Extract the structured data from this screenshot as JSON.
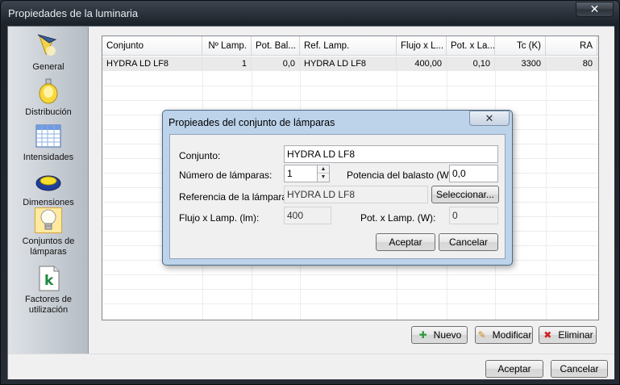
{
  "window": {
    "title": "Propiedades de la luminaria",
    "close_glyph": "✕"
  },
  "sidebar": {
    "items": [
      {
        "label": "General",
        "icon": "lamp-icon"
      },
      {
        "label": "Distribución",
        "icon": "light-distribution-icon"
      },
      {
        "label": "Intensidades",
        "icon": "table-grid-icon"
      },
      {
        "label": "Dimensiones",
        "icon": "luminaire-dimensions-icon"
      },
      {
        "label": "Conjuntos de lámparas",
        "icon": "lightbulb-icon",
        "active": true
      },
      {
        "label": "Factores de utilización",
        "icon": "k-factor-icon"
      }
    ]
  },
  "table": {
    "columns": [
      "Conjunto",
      "Nº Lamp.",
      "Pot. Bal...",
      "Ref. Lamp.",
      "Flujo x L...",
      "Pot. x La...",
      "Tc (K)",
      "RA"
    ],
    "rows": [
      [
        "HYDRA LD LF8",
        "1",
        "0,0",
        "HYDRA LD LF8",
        "400,00",
        "0,10",
        "3300",
        "80"
      ]
    ]
  },
  "actions": {
    "new_label": "Nuevo",
    "edit_label": "Modificar",
    "delete_label": "Eliminar"
  },
  "footer": {
    "ok_label": "Aceptar",
    "cancel_label": "Cancelar"
  },
  "dialog": {
    "title": "Propieades del conjunto de lámparas",
    "close_glyph": "✕",
    "conjunto_label": "Conjunto:",
    "conjunto_value": "HYDRA LD LF8",
    "num_lamps_label": "Número de lámparas:",
    "num_lamps_value": "1",
    "ballast_label": "Potencia del balasto (W):",
    "ballast_value": "0,0",
    "lamp_ref_label": "Referencia de la lámpara:",
    "lamp_ref_value": "HYDRA LD LF8",
    "select_label": "Seleccionar...",
    "flux_label": "Flujo x Lamp. (lm):",
    "flux_value": "400",
    "power_label": "Pot. x Lamp. (W):",
    "power_value": "0",
    "ok_label": "Aceptar",
    "cancel_label": "Cancelar"
  },
  "colors": {
    "accent_active": "#ffeaa0",
    "dialog_frame": "#bcd3ea"
  }
}
